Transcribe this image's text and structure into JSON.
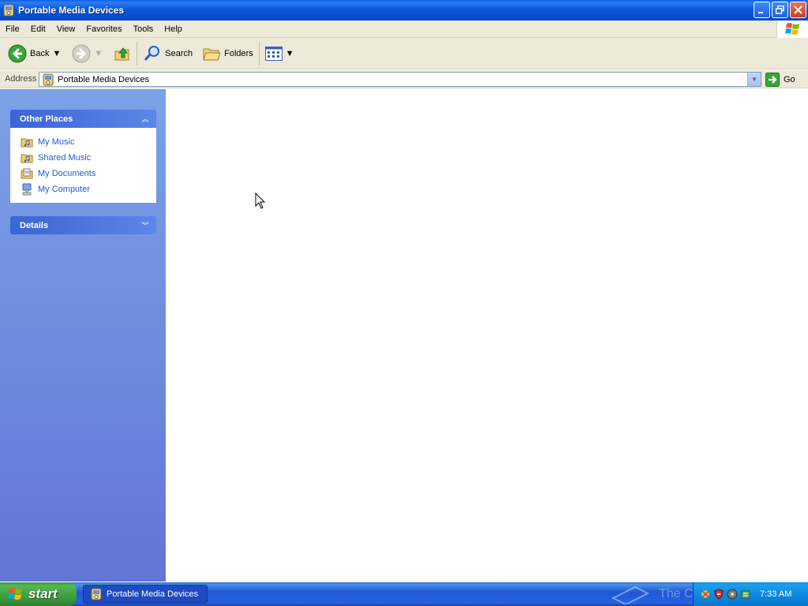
{
  "window": {
    "title": "Portable Media Devices"
  },
  "menu": [
    "File",
    "Edit",
    "View",
    "Favorites",
    "Tools",
    "Help"
  ],
  "toolbar": {
    "back_label": "Back",
    "search_label": "Search",
    "folders_label": "Folders"
  },
  "address": {
    "label": "Address",
    "value": "Portable Media Devices",
    "go_label": "Go"
  },
  "panels": {
    "other_places": {
      "title": "Other Places",
      "items": [
        {
          "label": "My Music",
          "icon": "music-folder-icon"
        },
        {
          "label": "Shared Music",
          "icon": "shared-music-folder-icon"
        },
        {
          "label": "My Documents",
          "icon": "documents-folder-icon"
        },
        {
          "label": "My Computer",
          "icon": "computer-icon"
        }
      ]
    },
    "details": {
      "title": "Details"
    }
  },
  "taskbar": {
    "start_label": "start",
    "task_label": "Portable Media Devices",
    "clock": "7:33 AM",
    "watermark": "The Computer Show"
  },
  "colors": {
    "titlebar": "#0a58d8",
    "taskbar": "#2157d7",
    "start": "#3a963a",
    "link": "#215dc6",
    "panel": "#7ba2e7"
  }
}
